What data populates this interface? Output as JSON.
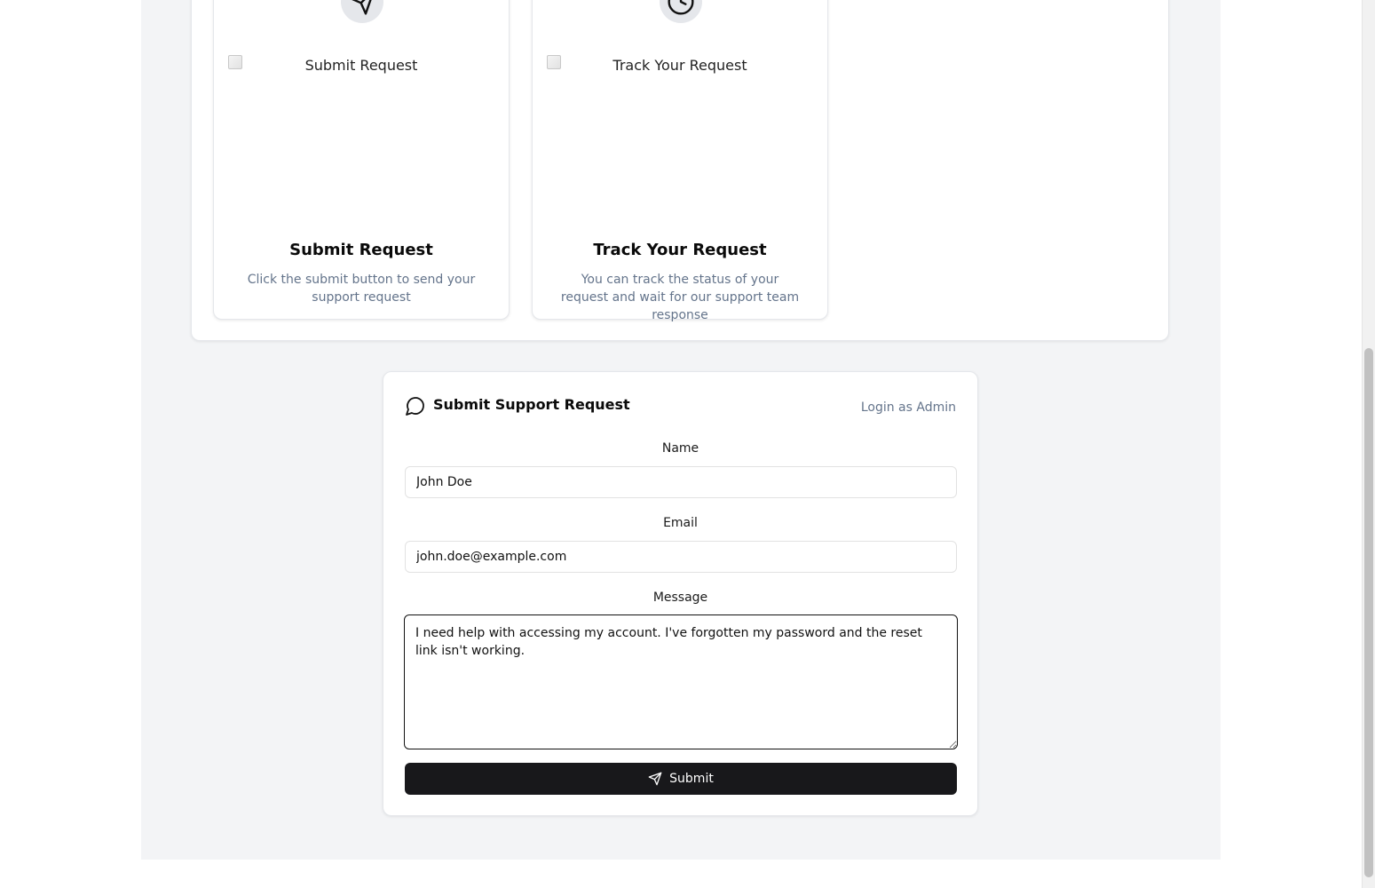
{
  "steps": [
    {
      "icon": "send-icon",
      "image_alt": "Submit Request",
      "title": "Submit Request",
      "description": "Click the submit button to send your support request"
    },
    {
      "icon": "clock-icon",
      "image_alt": "Track Your Request",
      "title": "Track Your Request",
      "description": "You can track the status of your request and wait for our support team response"
    }
  ],
  "form": {
    "icon": "message-circle-icon",
    "title": "Submit Support Request",
    "admin_link": "Login as Admin",
    "name_label": "Name",
    "name_value": "John Doe",
    "email_label": "Email",
    "email_value": "john.doe@example.com",
    "message_label": "Message",
    "message_value": "I need help with accessing my account. I've forgotten my password and the reset link isn't working.",
    "submit_label": "Submit"
  },
  "colors": {
    "page_background": "#f3f4f6",
    "button_background": "#18181b",
    "muted_text": "#64748b"
  }
}
